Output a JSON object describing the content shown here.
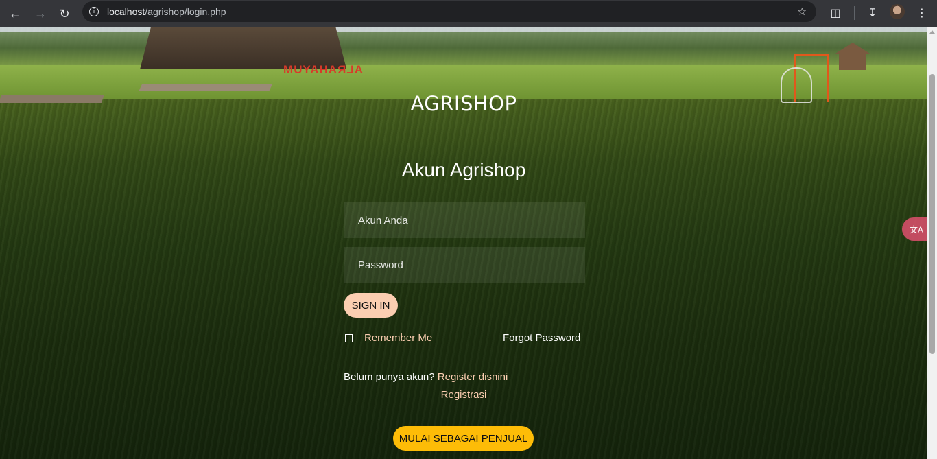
{
  "browser": {
    "url_host": "localhost",
    "url_path": "/agrishop/login.php",
    "back_icon": "arrow-left-icon",
    "forward_icon": "arrow-right-icon",
    "reload_icon": "reload-icon",
    "info_icon": "info-icon",
    "star_icon": "star-icon",
    "extensions_icon": "puzzle-icon",
    "download_icon": "download-icon",
    "menu_icon": "kebab-menu-icon"
  },
  "scene": {
    "sign_text": "ALRAHAYUM"
  },
  "login": {
    "brand": "AGRISHOP",
    "heading": "Akun Agrishop",
    "username_placeholder": "Akun Anda",
    "password_placeholder": "Password",
    "signin_label": "SIGN IN",
    "remember_label": "Remember Me",
    "forgot_label": "Forgot Password",
    "register_prompt": "Belum punya akun?",
    "register_link": "Register disnini",
    "registration_link": "Registrasi",
    "seller_label": "MULAI SEBAGAI PENJUAL"
  },
  "colors": {
    "accent_peach": "#fbceb1",
    "seller_yellow": "#fdbc07",
    "translate_pink": "#de506e"
  }
}
